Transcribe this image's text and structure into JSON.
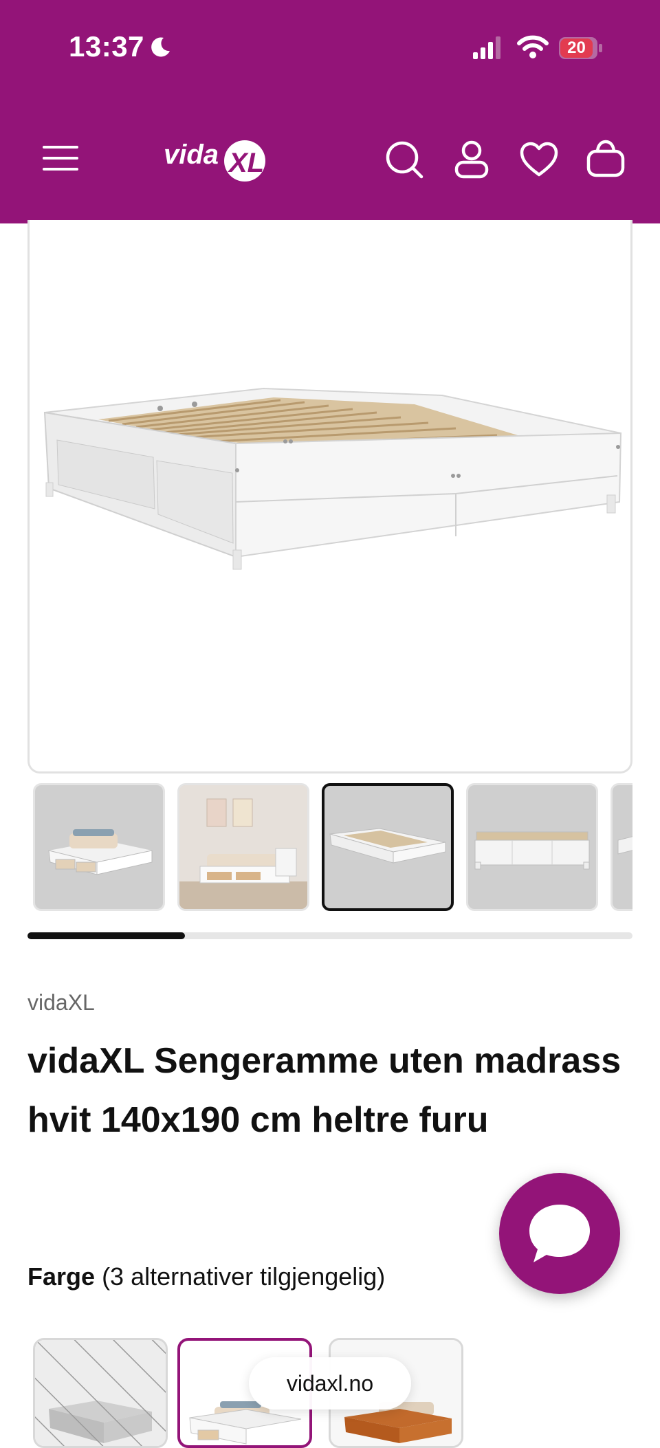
{
  "status_bar": {
    "time": "13:37",
    "battery": "20"
  },
  "header": {
    "logo_text": "vidaXL",
    "background_color": "#931478",
    "icons": [
      "menu-icon",
      "search-icon",
      "user-icon",
      "heart-icon",
      "bag-icon"
    ]
  },
  "gallery": {
    "thumbnails": 5,
    "active_index": 2,
    "scroll_progress": 0.26
  },
  "product": {
    "brand": "vidaXL",
    "title": "vidaXL Sengeramme uten madrass hvit 140x190 cm heltre furu",
    "color_label": "Farge",
    "color_options_text": "(3 alternativer tilgjengelig)",
    "color_options": [
      "grå",
      "hvit",
      "brun"
    ],
    "selected_color_index": 1
  },
  "browser": {
    "url": "vidaxl.no"
  },
  "colors": {
    "brand": "#931478",
    "text": "#111111",
    "muted": "#666666"
  }
}
